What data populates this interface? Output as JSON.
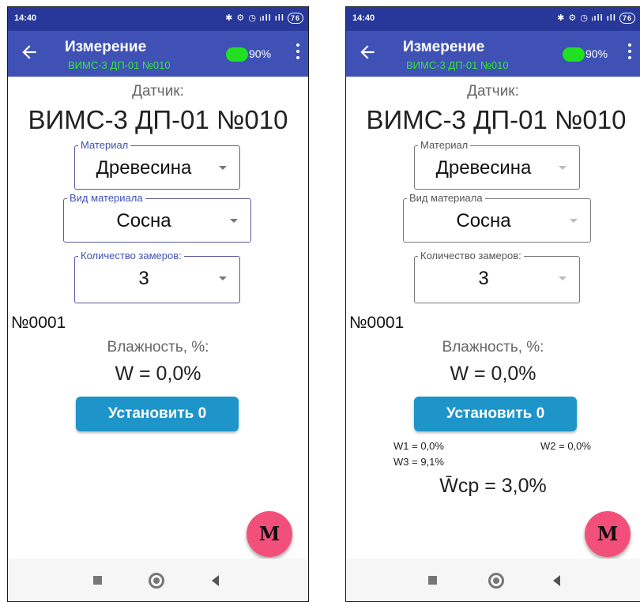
{
  "left": {
    "status": {
      "time": "14:40",
      "icons": "✱ ⚙ ◷ ᵢıll ıll",
      "battery": "76"
    },
    "appbar": {
      "title": "Измерение",
      "subtitle": "ВИМС-3 ДП-01 №010",
      "battery_percent": "90%",
      "battery_level": 0.9
    },
    "sensor_label": "Датчик:",
    "sensor_name": "ВИМС-3 ДП-01 №010",
    "material": {
      "label": "Материал",
      "value": "Древесина"
    },
    "material_type": {
      "label": "Вид материала",
      "value": "Сосна"
    },
    "measure_count": {
      "label": "Количество замеров:",
      "value": "3"
    },
    "record_number": "№0001",
    "humidity_label": "Влажность, %:",
    "humidity_value": "W = 0,0%",
    "set_zero_label": "Установить 0",
    "fab_label": "M"
  },
  "right": {
    "status": {
      "time": "14:40",
      "icons": "✱ ⚙ ◷ ᵢıll ıll",
      "battery": "76"
    },
    "appbar": {
      "title": "Измерение",
      "subtitle": "ВИМС-3 ДП-01 №010",
      "battery_percent": "90%",
      "battery_level": 0.9
    },
    "sensor_label": "Датчик:",
    "sensor_name": "ВИМС-3 ДП-01 №010",
    "material": {
      "label": "Материал",
      "value": "Древесина"
    },
    "material_type": {
      "label": "Вид материала",
      "value": "Сосна"
    },
    "measure_count": {
      "label": "Количество замеров:",
      "value": "3"
    },
    "record_number": "№0001",
    "humidity_label": "Влажность, %:",
    "humidity_value": "W = 0,0%",
    "set_zero_label": "Установить 0",
    "w1": "W1 = 0,0%",
    "w2": "W2 = 0,0%",
    "w3": "W3 = 9,1%",
    "average": "W̄ср = 3,0%",
    "fab_label": "M"
  },
  "colors": {
    "statusbar": "#27379a",
    "appbar": "#3f51b5",
    "accent_green": "#21e021",
    "button": "#1d95c9",
    "fab": "#f2507a"
  },
  "icons": {
    "back": "arrow-left-icon",
    "menu": "more-vert-icon",
    "fab": "m-logo-icon"
  }
}
